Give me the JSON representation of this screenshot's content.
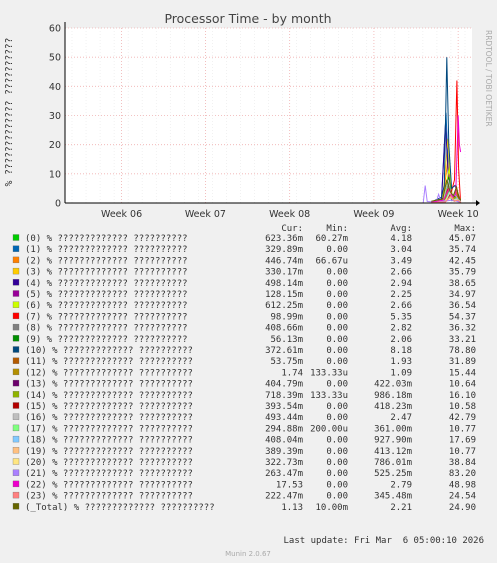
{
  "chart_data": {
    "type": "line",
    "title": "Processor Time - by month",
    "ylabel": "% ????????????? ??????????",
    "side_label": "RRDTOOL / TOBI OETIKER",
    "ylim": [
      0,
      60
    ],
    "yticks": [
      "0",
      "10",
      "20",
      "30",
      "40",
      "50",
      "60"
    ],
    "week_labels": [
      "Week 06",
      "Week 07",
      "Week 08",
      "Week 09",
      "Week 10"
    ],
    "legend_header": [
      "Cur:",
      "Min:",
      "Avg:",
      "Max:"
    ],
    "series": [
      {
        "label": "(0) % ????????????? ??????????",
        "color": "#00cc00",
        "cur": "623.36m",
        "min": "60.27m",
        "avg": "4.18",
        "max": "45.07",
        "points": [
          [
            0.9,
            0.3
          ],
          [
            0.92,
            1.2
          ],
          [
            0.935,
            2.0
          ],
          [
            0.942,
            7.0
          ],
          [
            0.95,
            3.0
          ],
          [
            0.957,
            1.5
          ],
          [
            0.965,
            2.5
          ],
          [
            0.972,
            0.6
          ]
        ]
      },
      {
        "label": "(1) % ????????????? ??????????",
        "color": "#0066b3",
        "cur": "329.89m",
        "min": "0.00",
        "avg": "3.04",
        "max": "35.74",
        "points": [
          [
            0.9,
            0.2
          ],
          [
            0.925,
            1.5
          ],
          [
            0.936,
            31.0
          ],
          [
            0.944,
            4.0
          ],
          [
            0.95,
            1.0
          ],
          [
            0.958,
            3.0
          ],
          [
            0.966,
            1.5
          ],
          [
            0.972,
            0.3
          ]
        ]
      },
      {
        "label": "(2) % ????????????? ??????????",
        "color": "#ff8000",
        "cur": "446.74m",
        "min": "66.67u",
        "avg": "3.49",
        "max": "42.45",
        "points": [
          [
            0.9,
            0.2
          ],
          [
            0.928,
            0.8
          ],
          [
            0.94,
            14.0
          ],
          [
            0.947,
            4.0
          ],
          [
            0.954,
            2.0
          ],
          [
            0.962,
            3.5
          ],
          [
            0.968,
            1.0
          ],
          [
            0.972,
            0.4
          ]
        ]
      },
      {
        "label": "(3) % ????????????? ??????????",
        "color": "#ffcc00",
        "cur": "330.17m",
        "min": "0.00",
        "avg": "2.66",
        "max": "35.79",
        "points": [
          [
            0.9,
            0.1
          ],
          [
            0.928,
            1.0
          ],
          [
            0.941,
            22.0
          ],
          [
            0.948,
            3.0
          ],
          [
            0.955,
            1.5
          ],
          [
            0.963,
            2.0
          ],
          [
            0.969,
            0.8
          ],
          [
            0.972,
            0.3
          ]
        ]
      },
      {
        "label": "(4) % ????????????? ??????????",
        "color": "#330099",
        "cur": "498.14m",
        "min": "0.00",
        "avg": "2.94",
        "max": "38.65",
        "points": [
          [
            0.9,
            0.2
          ],
          [
            0.925,
            1.0
          ],
          [
            0.935,
            27.0
          ],
          [
            0.943,
            6.0
          ],
          [
            0.951,
            1.0
          ],
          [
            0.959,
            1.8
          ],
          [
            0.966,
            0.8
          ],
          [
            0.972,
            0.5
          ]
        ]
      },
      {
        "label": "(5) % ????????????? ??????????",
        "color": "#990099",
        "cur": "128.15m",
        "min": "0.00",
        "avg": "2.25",
        "max": "34.97",
        "points": [
          [
            0.9,
            0.1
          ],
          [
            0.93,
            0.8
          ],
          [
            0.943,
            10.0
          ],
          [
            0.952,
            2.0
          ],
          [
            0.96,
            3.0
          ],
          [
            0.967,
            1.0
          ],
          [
            0.972,
            0.1
          ]
        ]
      },
      {
        "label": "(6) % ????????????? ??????????",
        "color": "#ccff00",
        "cur": "612.25m",
        "min": "0.00",
        "avg": "2.66",
        "max": "36.54",
        "points": [
          [
            0.9,
            0.3
          ],
          [
            0.93,
            1.0
          ],
          [
            0.944,
            12.0
          ],
          [
            0.951,
            2.5
          ],
          [
            0.958,
            1.2
          ],
          [
            0.965,
            1.6
          ],
          [
            0.972,
            0.6
          ]
        ]
      },
      {
        "label": "(7) % ????????????? ??????????",
        "color": "#ff0000",
        "cur": "98.99m",
        "min": "0.00",
        "avg": "5.35",
        "max": "54.37",
        "points": [
          [
            0.9,
            0.2
          ],
          [
            0.93,
            1.5
          ],
          [
            0.942,
            5.0
          ],
          [
            0.95,
            4.0
          ],
          [
            0.957,
            8.0
          ],
          [
            0.963,
            42.0
          ],
          [
            0.967,
            12.0
          ],
          [
            0.972,
            0.1
          ]
        ]
      },
      {
        "label": "(8) % ????????????? ??????????",
        "color": "#808080",
        "cur": "408.66m",
        "min": "0.00",
        "avg": "2.82",
        "max": "36.32",
        "points": [
          [
            0.9,
            0.2
          ],
          [
            0.93,
            1.0
          ],
          [
            0.941,
            6.0
          ],
          [
            0.949,
            2.0
          ],
          [
            0.957,
            1.5
          ],
          [
            0.965,
            2.0
          ],
          [
            0.972,
            0.4
          ]
        ]
      },
      {
        "label": "(9) % ????????????? ??????????",
        "color": "#008f00",
        "cur": "56.13m",
        "min": "0.00",
        "avg": "2.06",
        "max": "33.21",
        "points": [
          [
            0.9,
            0.1
          ],
          [
            0.93,
            0.5
          ],
          [
            0.943,
            9.0
          ],
          [
            0.951,
            1.0
          ],
          [
            0.959,
            2.5
          ],
          [
            0.966,
            1.0
          ],
          [
            0.972,
            0.1
          ]
        ]
      },
      {
        "label": "(10) % ????????????? ??????????",
        "color": "#00487d",
        "cur": "372.61m",
        "min": "0.00",
        "avg": "8.18",
        "max": "78.80",
        "points": [
          [
            0.9,
            0.3
          ],
          [
            0.925,
            2.0
          ],
          [
            0.932,
            6.0
          ],
          [
            0.938,
            50.0
          ],
          [
            0.943,
            20.0
          ],
          [
            0.95,
            5.0
          ],
          [
            0.958,
            6.0
          ],
          [
            0.966,
            3.0
          ],
          [
            0.972,
            0.4
          ]
        ]
      },
      {
        "label": "(11) % ????????????? ??????????",
        "color": "#b35a00",
        "cur": "53.75m",
        "min": "0.00",
        "avg": "1.93",
        "max": "31.89",
        "points": [
          [
            0.9,
            0.1
          ],
          [
            0.93,
            0.6
          ],
          [
            0.944,
            4.0
          ],
          [
            0.953,
            1.0
          ],
          [
            0.961,
            5.0
          ],
          [
            0.968,
            1.0
          ],
          [
            0.972,
            0.1
          ]
        ]
      },
      {
        "label": "(12) % ????????????? ??????????",
        "color": "#b38f00",
        "cur": "1.74",
        "min": "133.33u",
        "avg": "1.09",
        "max": "15.44",
        "points": [
          [
            0.9,
            0.5
          ],
          [
            0.93,
            1.0
          ],
          [
            0.945,
            3.0
          ],
          [
            0.952,
            1.5
          ],
          [
            0.96,
            2.0
          ],
          [
            0.966,
            1.2
          ],
          [
            0.972,
            1.7
          ]
        ]
      },
      {
        "label": "(13) % ????????????? ??????????",
        "color": "#6b006b",
        "cur": "404.79m",
        "min": "0.00",
        "avg": "422.03m",
        "max": "10.64",
        "points": [
          [
            0.9,
            0.1
          ],
          [
            0.935,
            0.5
          ],
          [
            0.946,
            3.0
          ],
          [
            0.955,
            0.8
          ],
          [
            0.962,
            1.5
          ],
          [
            0.972,
            0.4
          ]
        ]
      },
      {
        "label": "(14) % ????????????? ??????????",
        "color": "#8fb300",
        "cur": "718.39m",
        "min": "133.33u",
        "avg": "986.18m",
        "max": "16.10",
        "points": [
          [
            0.9,
            0.2
          ],
          [
            0.935,
            0.8
          ],
          [
            0.944,
            5.0
          ],
          [
            0.952,
            1.2
          ],
          [
            0.96,
            1.8
          ],
          [
            0.972,
            0.7
          ]
        ]
      },
      {
        "label": "(15) % ????????????? ??????????",
        "color": "#b30000",
        "cur": "393.54m",
        "min": "0.00",
        "avg": "418.23m",
        "max": "10.58",
        "points": [
          [
            0.9,
            0.1
          ],
          [
            0.935,
            0.4
          ],
          [
            0.947,
            2.5
          ],
          [
            0.956,
            0.8
          ],
          [
            0.964,
            1.2
          ],
          [
            0.972,
            0.4
          ]
        ]
      },
      {
        "label": "(16) % ????????????? ??????????",
        "color": "#bebebe",
        "cur": "493.44m",
        "min": "0.00",
        "avg": "2.47",
        "max": "42.79",
        "points": [
          [
            0.9,
            0.2
          ],
          [
            0.93,
            1.0
          ],
          [
            0.942,
            8.0
          ],
          [
            0.95,
            2.0
          ],
          [
            0.958,
            3.0
          ],
          [
            0.966,
            1.2
          ],
          [
            0.972,
            0.5
          ]
        ]
      },
      {
        "label": "(17) % ????????????? ??????????",
        "color": "#80ff80",
        "cur": "294.88m",
        "min": "200.00u",
        "avg": "361.00m",
        "max": "10.77",
        "points": [
          [
            0.9,
            0.1
          ],
          [
            0.935,
            0.4
          ],
          [
            0.948,
            2.0
          ],
          [
            0.957,
            0.6
          ],
          [
            0.965,
            1.0
          ],
          [
            0.972,
            0.3
          ]
        ]
      },
      {
        "label": "(18) % ????????????? ??????????",
        "color": "#80c9ff",
        "cur": "408.04m",
        "min": "0.00",
        "avg": "927.90m",
        "max": "17.69",
        "points": [
          [
            0.9,
            0.2
          ],
          [
            0.935,
            0.8
          ],
          [
            0.945,
            4.0
          ],
          [
            0.954,
            1.0
          ],
          [
            0.962,
            1.5
          ],
          [
            0.972,
            0.4
          ]
        ]
      },
      {
        "label": "(19) % ????????????? ??????????",
        "color": "#ffc080",
        "cur": "389.39m",
        "min": "0.00",
        "avg": "413.12m",
        "max": "10.77",
        "points": [
          [
            0.9,
            0.1
          ],
          [
            0.935,
            0.4
          ],
          [
            0.947,
            2.0
          ],
          [
            0.956,
            0.7
          ],
          [
            0.964,
            1.0
          ],
          [
            0.972,
            0.4
          ]
        ]
      },
      {
        "label": "(20) % ????????????? ??????????",
        "color": "#ffe680",
        "cur": "322.73m",
        "min": "0.00",
        "avg": "786.01m",
        "max": "38.84",
        "points": [
          [
            0.9,
            0.1
          ],
          [
            0.935,
            0.6
          ],
          [
            0.946,
            3.5
          ],
          [
            0.955,
            1.0
          ],
          [
            0.963,
            1.2
          ],
          [
            0.972,
            0.3
          ]
        ]
      },
      {
        "label": "(21) % ????????????? ??????????",
        "color": "#aa80ff",
        "cur": "263.47m",
        "min": "0.00",
        "avg": "525.25m",
        "max": "83.20",
        "points": [
          [
            0.88,
            0.0
          ],
          [
            0.885,
            6.0
          ],
          [
            0.89,
            0.5
          ],
          [
            0.912,
            0.3
          ],
          [
            0.918,
            3.0
          ],
          [
            0.924,
            0.4
          ],
          [
            0.95,
            1.0
          ],
          [
            0.972,
            0.3
          ]
        ]
      },
      {
        "label": "(22) % ????????????? ??????????",
        "color": "#ee00cc",
        "cur": "17.53",
        "min": "0.00",
        "avg": "2.79",
        "max": "48.98",
        "points": [
          [
            0.9,
            0.2
          ],
          [
            0.93,
            1.0
          ],
          [
            0.944,
            5.0
          ],
          [
            0.952,
            2.0
          ],
          [
            0.96,
            3.0
          ],
          [
            0.966,
            30.0
          ],
          [
            0.969,
            20.0
          ],
          [
            0.972,
            17.5
          ]
        ]
      },
      {
        "label": "(23) % ????????????? ??????????",
        "color": "#ff8080",
        "cur": "222.47m",
        "min": "0.00",
        "avg": "345.48m",
        "max": "24.54",
        "points": [
          [
            0.9,
            0.1
          ],
          [
            0.935,
            0.4
          ],
          [
            0.948,
            2.5
          ],
          [
            0.957,
            0.6
          ],
          [
            0.965,
            1.0
          ],
          [
            0.972,
            0.2
          ]
        ]
      },
      {
        "label": "(_Total) % ????????????? ??????????",
        "color": "#666600",
        "cur": "1.13",
        "min": "10.00m",
        "avg": "2.21",
        "max": "24.90",
        "points": [
          [
            0.9,
            0.6
          ],
          [
            0.928,
            1.4
          ],
          [
            0.938,
            8.0
          ],
          [
            0.946,
            4.0
          ],
          [
            0.954,
            2.5
          ],
          [
            0.962,
            5.5
          ],
          [
            0.968,
            2.0
          ],
          [
            0.972,
            1.1
          ]
        ]
      }
    ],
    "last_update": "Last update: Fri Mar  6 05:00:10 2026",
    "footer": "Munin 2.0.67"
  }
}
